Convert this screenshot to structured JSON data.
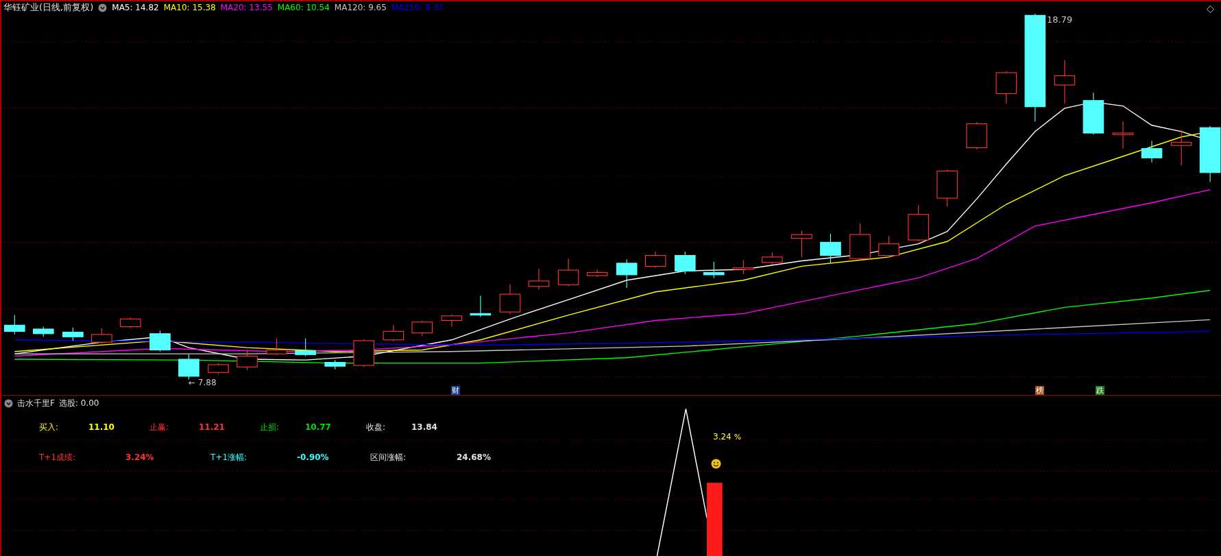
{
  "main_chart": {
    "title": "华钰矿业(日线,前复权)",
    "indicators": [
      {
        "label": "MA5: 14.82",
        "color": "#ffffff"
      },
      {
        "label": "MA10: 15.38",
        "color": "#ffff00"
      },
      {
        "label": "MA20: 13.55",
        "color": "#ff00ff"
      },
      {
        "label": "MA60: 10.54",
        "color": "#00ff00"
      },
      {
        "label": "MA120: 9.65",
        "color": "#c8c8c8"
      },
      {
        "label": "MA250: 9.33",
        "color": "#0000ff"
      }
    ],
    "high_label": "← 18.79",
    "low_label": "← 7.88",
    "badges": [
      {
        "text": "财",
        "color": "#1a3f8a"
      },
      {
        "text": "榜",
        "color": "#a0521a"
      },
      {
        "text": "跌",
        "color": "#1f7a1f"
      }
    ]
  },
  "sub_panel": {
    "title": "击水千里F",
    "reading": "选股: 0.00",
    "price_levels": [
      {
        "label": "买入:",
        "value": "11.10",
        "color": "#ffff00"
      },
      {
        "label": "止赢:",
        "value": "11.21",
        "color": "#ff3030"
      },
      {
        "label": "止损:",
        "value": "10.77",
        "color": "#00e000"
      },
      {
        "label": "收盘:",
        "value": "13.84",
        "color": "#e0e0e0"
      }
    ],
    "results": [
      {
        "label": "T+1成绩:",
        "value": "3.24%",
        "color": "#ff3030"
      },
      {
        "label": "T+1涨幅:",
        "value": "-0.90%",
        "color": "#33ffff"
      },
      {
        "label": "区间涨幅:",
        "value": "24.68%",
        "color": "#e0e0e0"
      }
    ],
    "marker_value": "3.24",
    "marker_unit": "%"
  }
}
